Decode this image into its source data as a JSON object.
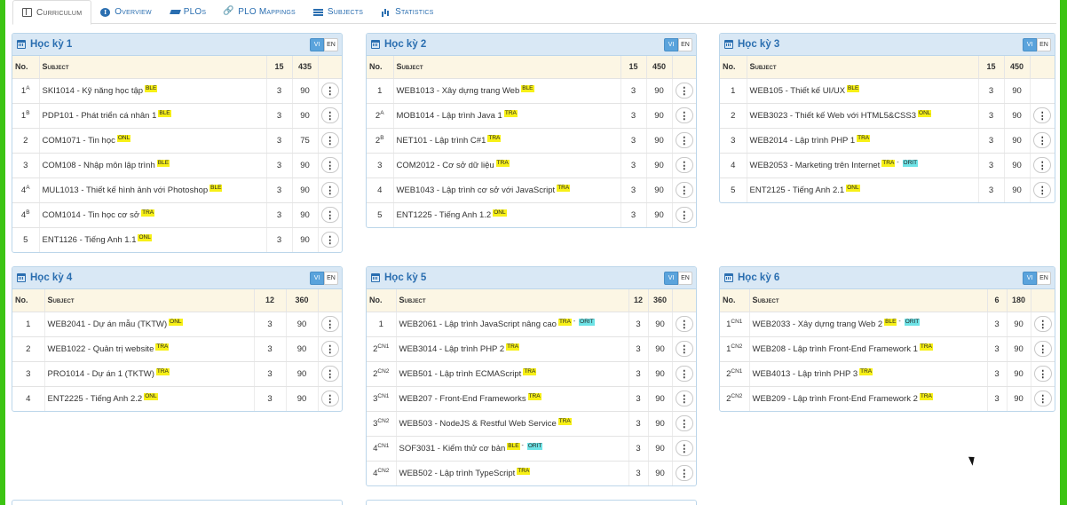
{
  "tabs": [
    {
      "label": "Curriculum",
      "icon": "book-icon",
      "active": true
    },
    {
      "label": "Overview",
      "icon": "info-circle-icon",
      "active": false
    },
    {
      "label": "PLOs",
      "icon": "graduation-cap-icon",
      "active": false
    },
    {
      "label": "PLO Mappings",
      "icon": "link-icon",
      "active": false
    },
    {
      "label": "Subjects",
      "icon": "list-icon",
      "active": false
    },
    {
      "label": "Statistics",
      "icon": "bar-chart-icon",
      "active": false
    }
  ],
  "lang": {
    "vi": "VI",
    "en": "EN"
  },
  "headers": {
    "no": "No.",
    "subject": "Subject"
  },
  "semesters": [
    {
      "title": "Học kỳ 1",
      "credits": "15",
      "hours": "435",
      "rows": [
        {
          "no": "1",
          "sup": "A",
          "subject": "SKI1014 - Kỹ năng học tập",
          "tags": [
            "BLE"
          ],
          "cr": "3",
          "h": "90",
          "menu": true
        },
        {
          "no": "1",
          "sup": "B",
          "subject": "PDP101 - Phát triển cá nhân 1",
          "tags": [
            "BLE"
          ],
          "cr": "3",
          "h": "90",
          "menu": true
        },
        {
          "no": "2",
          "sup": "",
          "subject": "COM1071 - Tin học",
          "tags": [
            "ONL"
          ],
          "cr": "3",
          "h": "75",
          "menu": true
        },
        {
          "no": "3",
          "sup": "",
          "subject": "COM108 - Nhập môn lập trình",
          "tags": [
            "BLE"
          ],
          "cr": "3",
          "h": "90",
          "menu": true
        },
        {
          "no": "4",
          "sup": "A",
          "subject": "MUL1013 - Thiết kế hình ảnh với Photoshop",
          "tags": [
            "BLE"
          ],
          "cr": "3",
          "h": "90",
          "menu": true
        },
        {
          "no": "4",
          "sup": "B",
          "subject": "COM1014 - Tin học cơ sở",
          "tags": [
            "TRA"
          ],
          "cr": "3",
          "h": "90",
          "menu": true
        },
        {
          "no": "5",
          "sup": "",
          "subject": "ENT1126 - Tiếng Anh 1.1",
          "tags": [
            "ONL"
          ],
          "cr": "3",
          "h": "90",
          "menu": true
        }
      ]
    },
    {
      "title": "Học kỳ 2",
      "credits": "15",
      "hours": "450",
      "rows": [
        {
          "no": "1",
          "sup": "",
          "subject": "WEB1013 - Xây dựng trang Web",
          "tags": [
            "BLE"
          ],
          "cr": "3",
          "h": "90",
          "menu": true
        },
        {
          "no": "2",
          "sup": "A",
          "subject": "MOB1014 - Lập trình Java 1",
          "tags": [
            "TRA"
          ],
          "cr": "3",
          "h": "90",
          "menu": true
        },
        {
          "no": "2",
          "sup": "B",
          "subject": "NET101 - Lập trình C#1",
          "tags": [
            "TRA"
          ],
          "cr": "3",
          "h": "90",
          "menu": true
        },
        {
          "no": "3",
          "sup": "",
          "subject": "COM2012 - Cơ sở dữ liệu",
          "tags": [
            "TRA"
          ],
          "cr": "3",
          "h": "90",
          "menu": true
        },
        {
          "no": "4",
          "sup": "",
          "subject": "WEB1043 - Lập trình cơ sở với JavaScript",
          "tags": [
            "TRA"
          ],
          "cr": "3",
          "h": "90",
          "menu": true
        },
        {
          "no": "5",
          "sup": "",
          "subject": "ENT1225 - Tiếng Anh 1.2",
          "tags": [
            "ONL"
          ],
          "cr": "3",
          "h": "90",
          "menu": true
        }
      ]
    },
    {
      "title": "Học kỳ 3",
      "credits": "15",
      "hours": "450",
      "rows": [
        {
          "no": "1",
          "sup": "",
          "subject": "WEB105 - Thiết kế UI/UX",
          "tags": [
            "BLE"
          ],
          "cr": "3",
          "h": "90",
          "menu": false
        },
        {
          "no": "2",
          "sup": "",
          "subject": "WEB3023 - Thiết kế Web với HTML5&CSS3",
          "tags": [
            "ONL"
          ],
          "cr": "3",
          "h": "90",
          "menu": true
        },
        {
          "no": "3",
          "sup": "",
          "subject": "WEB2014 - Lập trình PHP 1",
          "tags": [
            "TRA"
          ],
          "cr": "3",
          "h": "90",
          "menu": true
        },
        {
          "no": "4",
          "sup": "",
          "subject": "WEB2053 - Marketing trên Internet",
          "tags": [
            "TRA",
            "ORIT"
          ],
          "cr": "3",
          "h": "90",
          "menu": true
        },
        {
          "no": "5",
          "sup": "",
          "subject": "ENT2125 - Tiếng Anh 2.1",
          "tags": [
            "ONL"
          ],
          "cr": "3",
          "h": "90",
          "menu": true
        }
      ]
    },
    {
      "title": "Học kỳ 4",
      "credits": "12",
      "hours": "360",
      "rows": [
        {
          "no": "1",
          "sup": "",
          "subject": "WEB2041 - Dự án mẫu (TKTW)",
          "tags": [
            "ONL"
          ],
          "cr": "3",
          "h": "90",
          "menu": true
        },
        {
          "no": "2",
          "sup": "",
          "subject": "WEB1022 - Quản trị website",
          "tags": [
            "TRA"
          ],
          "cr": "3",
          "h": "90",
          "menu": true
        },
        {
          "no": "3",
          "sup": "",
          "subject": "PRO1014 - Dự án 1 (TKTW)",
          "tags": [
            "TRA"
          ],
          "cr": "3",
          "h": "90",
          "menu": true
        },
        {
          "no": "4",
          "sup": "",
          "subject": "ENT2225 - Tiếng Anh 2.2",
          "tags": [
            "ONL"
          ],
          "cr": "3",
          "h": "90",
          "menu": true
        }
      ]
    },
    {
      "title": "Học kỳ 5",
      "credits": "12",
      "hours": "360",
      "rows": [
        {
          "no": "1",
          "sup": "",
          "subject": "WEB2061 - Lập trình JavaScript nâng cao",
          "tags": [
            "TRA",
            "ORIT"
          ],
          "cr": "3",
          "h": "90",
          "menu": true
        },
        {
          "no": "2",
          "sup": "CN1",
          "subject": "WEB3014 - Lập trình PHP 2",
          "tags": [
            "TRA"
          ],
          "cr": "3",
          "h": "90",
          "menu": true
        },
        {
          "no": "2",
          "sup": "CN2",
          "subject": "WEB501 - Lập trình ECMAScript",
          "tags": [
            "TRA"
          ],
          "cr": "3",
          "h": "90",
          "menu": true
        },
        {
          "no": "3",
          "sup": "CN1",
          "subject": "WEB207 - Front-End Frameworks",
          "tags": [
            "TRA"
          ],
          "cr": "3",
          "h": "90",
          "menu": true
        },
        {
          "no": "3",
          "sup": "CN2",
          "subject": "WEB503 - NodeJS & Restful Web Service",
          "tags": [
            "TRA"
          ],
          "cr": "3",
          "h": "90",
          "menu": true
        },
        {
          "no": "4",
          "sup": "CN1",
          "subject": "SOF3031 - Kiểm thử cơ bản",
          "tags": [
            "BLE",
            "ORIT"
          ],
          "cr": "3",
          "h": "90",
          "menu": true
        },
        {
          "no": "4",
          "sup": "CN2",
          "subject": "WEB502 - Lập trình TypeScript",
          "tags": [
            "TRA"
          ],
          "cr": "3",
          "h": "90",
          "menu": true
        }
      ]
    },
    {
      "title": "Học kỳ 6",
      "credits": "6",
      "hours": "180",
      "rows": [
        {
          "no": "1",
          "sup": "CN1",
          "subject": "WEB2033 - Xây dựng trang Web 2",
          "tags": [
            "BLE",
            "ORIT"
          ],
          "cr": "3",
          "h": "90",
          "menu": true
        },
        {
          "no": "1",
          "sup": "CN2",
          "subject": "WEB208 - Lập trình Front-End Framework 1",
          "tags": [
            "TRA"
          ],
          "cr": "3",
          "h": "90",
          "menu": true
        },
        {
          "no": "2",
          "sup": "CN1",
          "subject": "WEB4013 - Lập trình PHP 3",
          "tags": [
            "TRA"
          ],
          "cr": "3",
          "h": "90",
          "menu": true
        },
        {
          "no": "2",
          "sup": "CN2",
          "subject": "WEB209 - Lập trình Front-End Framework 2",
          "tags": [
            "TRA"
          ],
          "cr": "3",
          "h": "90",
          "menu": true
        }
      ]
    }
  ],
  "colors": {
    "accent": "#2a6eb0",
    "panel_header": "#d9e8f5",
    "tag_yellow": "#f7f017",
    "tag_cyan": "#6ee3e6",
    "frame_green": "#3cc413"
  }
}
